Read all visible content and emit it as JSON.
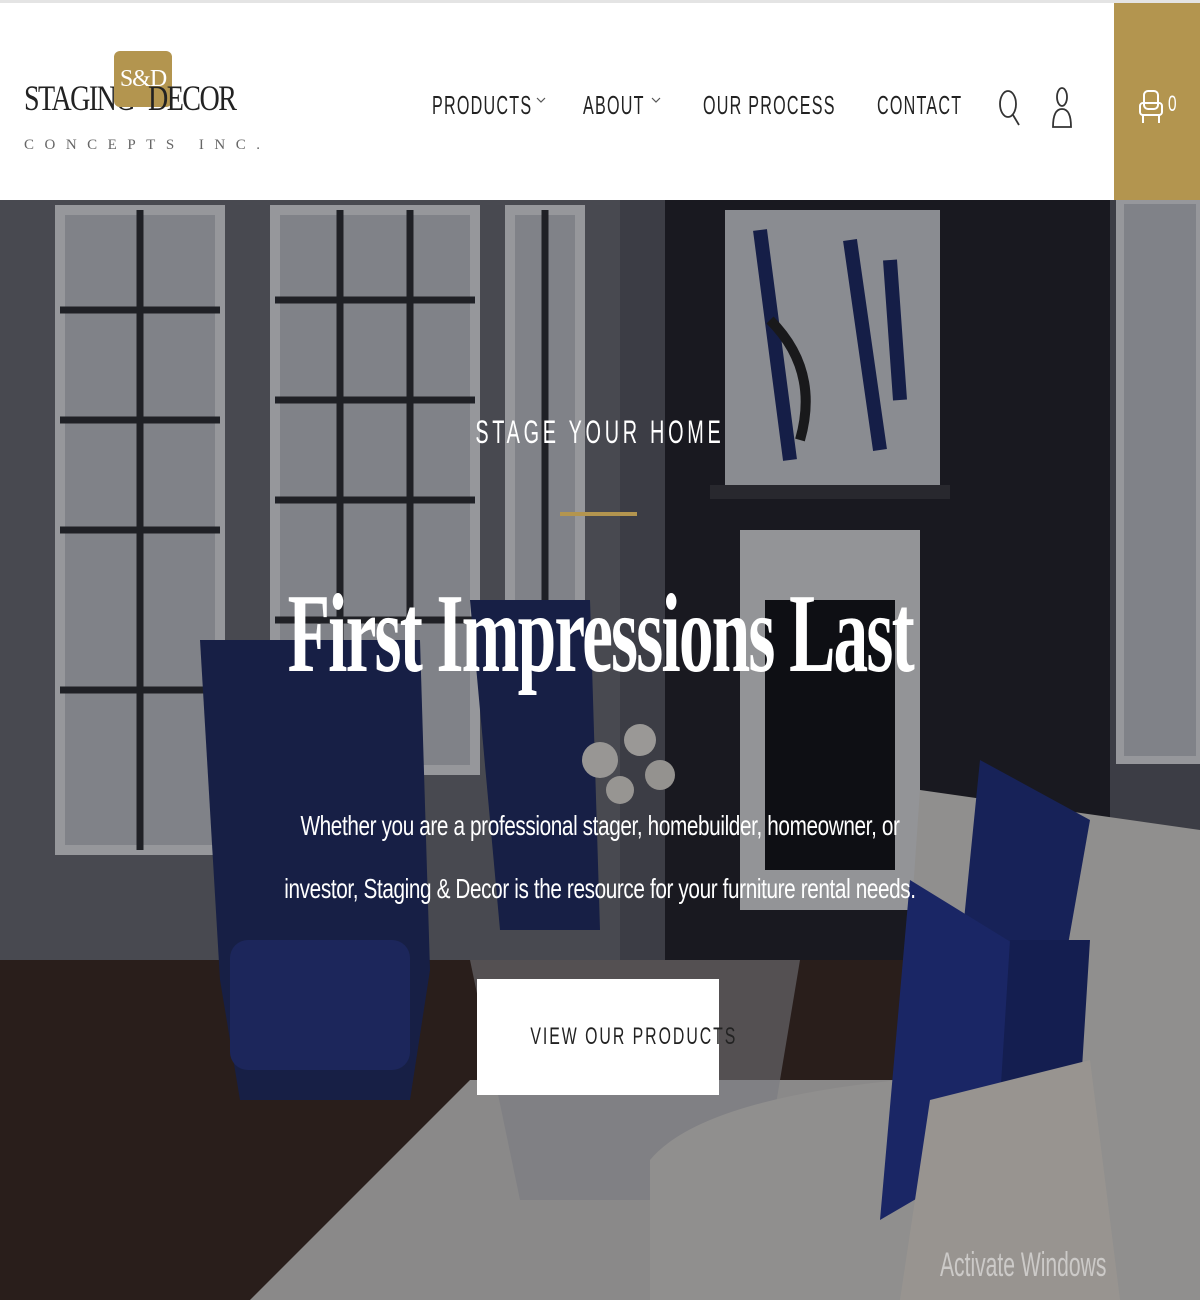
{
  "brand": {
    "word_left": "STAGING",
    "monogram": "S&D",
    "word_right": "DECOR",
    "tagline": "CONCEPTS INC.",
    "accent_color": "#b3954f"
  },
  "nav": {
    "items": [
      {
        "label": "PRODUCTS",
        "has_dropdown": true
      },
      {
        "label": "ABOUT",
        "has_dropdown": true
      },
      {
        "label": "OUR PROCESS",
        "has_dropdown": false
      },
      {
        "label": "CONTACT",
        "has_dropdown": false
      }
    ],
    "icons": {
      "search": "search-icon",
      "account": "user-icon",
      "cart": "armchair-cart-icon"
    },
    "cart_count": "0"
  },
  "hero": {
    "eyebrow": "STAGE YOUR HOME",
    "headline": "First Impressions Last",
    "body_line1": "Whether you are a professional stager, homebuilder, homeowner, or",
    "body_line2": "investor, Staging & Decor is the resource for your furniture rental needs.",
    "cta_label": "VIEW OUR PRODUCTS"
  },
  "system": {
    "watermark": "Activate Windows"
  }
}
